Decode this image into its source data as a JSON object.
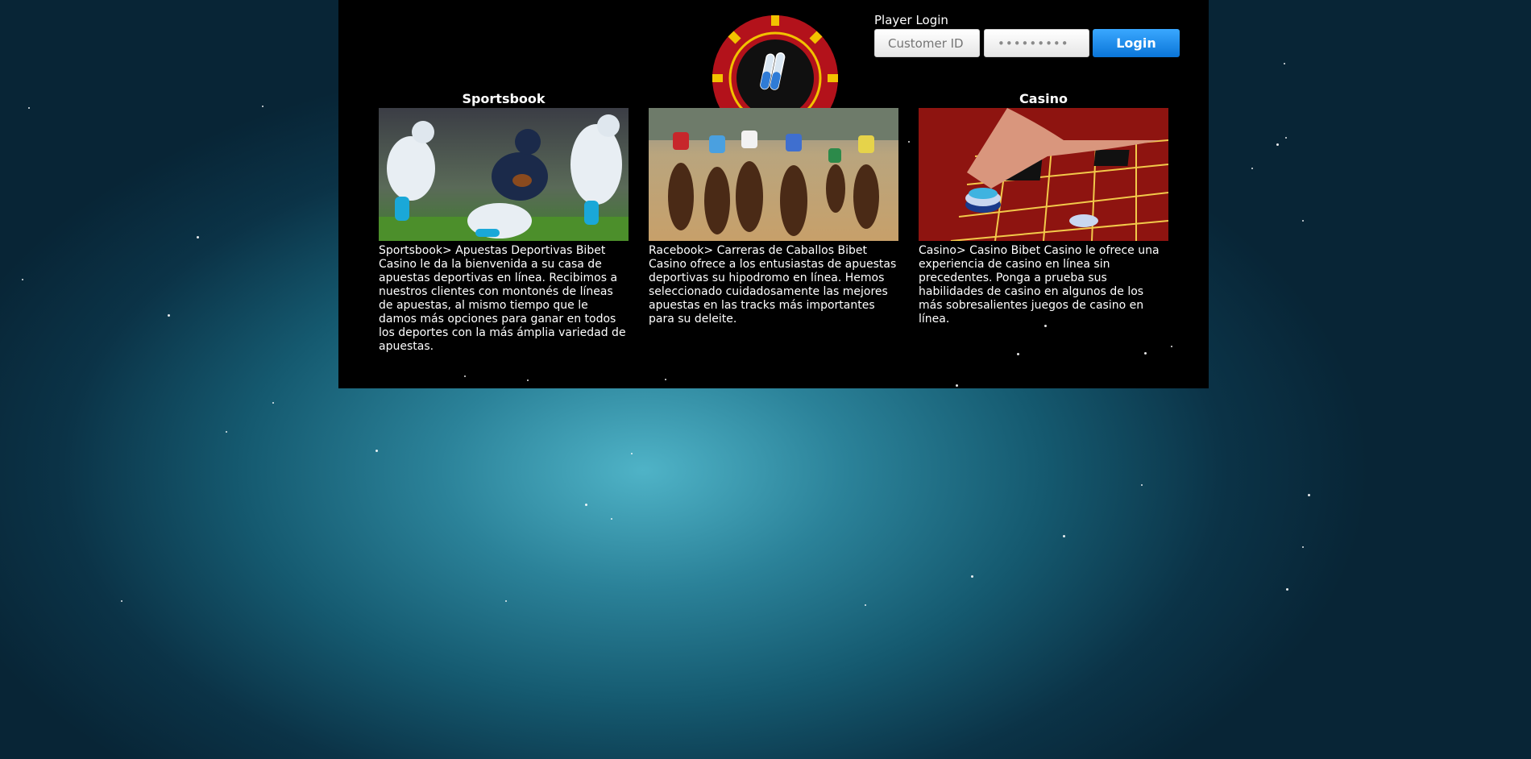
{
  "login": {
    "title": "Player Login",
    "customer_placeholder": "Customer ID",
    "password_value": "•••••••••",
    "button_label": "Login"
  },
  "sections": [
    {
      "title": "Sportsbook",
      "image": "football-action-photo",
      "text": "Sportsbook> Apuestas Deportivas Bibet Casino le da la bienvenida a su casa de apuestas deportivas en línea. Recibimos a nuestros clientes con montonés de líneas de apuestas, al mismo tiempo que le damos más opciones para ganar en todos los deportes con la más ámplia variedad de apuestas."
    },
    {
      "title": "",
      "image": "horse-race-photo",
      "text": "Racebook> Carreras de Caballos Bibet Casino ofrece a los entusiastas de apuestas deportivas su hipodromo en línea. Hemos seleccionado cuidadosamente las mejores apuestas en las tracks más importantes para su deleite."
    },
    {
      "title": "Casino",
      "image": "roulette-table-photo",
      "text": "Casino> Casino Bibet Casino le ofrece una experiencia de casino en línea sin precedentes. Ponga a prueba sus habilidades de casino en algunos de los más sobresalientes juegos de casino en línea."
    }
  ],
  "colors": {
    "panel": "#000000",
    "login_button": "#0a75d8",
    "chip_red": "#b3121b",
    "chip_yellow": "#f2c200"
  }
}
